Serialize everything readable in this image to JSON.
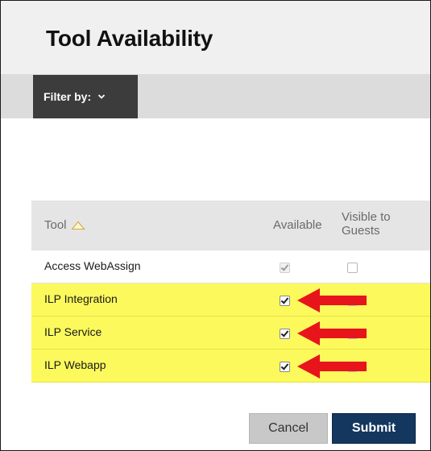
{
  "header": {
    "title": "Tool Availability"
  },
  "filter": {
    "label": "Filter by:"
  },
  "table": {
    "columns": {
      "tool": "Tool",
      "available": "Available",
      "visible_line1": "Visible to",
      "visible_line2": "Guests"
    },
    "sort": {
      "column": "Tool",
      "direction": "ascending"
    },
    "rows": [
      {
        "name": "Access WebAssign",
        "available": true,
        "available_enabled": false,
        "visible_to_guests": false,
        "highlighted": false
      },
      {
        "name": "ILP Integration",
        "available": true,
        "available_enabled": true,
        "visible_to_guests": false,
        "highlighted": true
      },
      {
        "name": "ILP Service",
        "available": true,
        "available_enabled": true,
        "visible_to_guests": false,
        "highlighted": true
      },
      {
        "name": "ILP Webapp",
        "available": true,
        "available_enabled": true,
        "visible_to_guests": false,
        "highlighted": true
      }
    ]
  },
  "buttons": {
    "cancel": "Cancel",
    "submit": "Submit"
  },
  "annotations": {
    "arrow_color": "#e8141c",
    "highlight_color": "#fbf95c"
  },
  "colors": {
    "submit_bg": "#13375f",
    "filter_bg": "#3c3c3c"
  }
}
